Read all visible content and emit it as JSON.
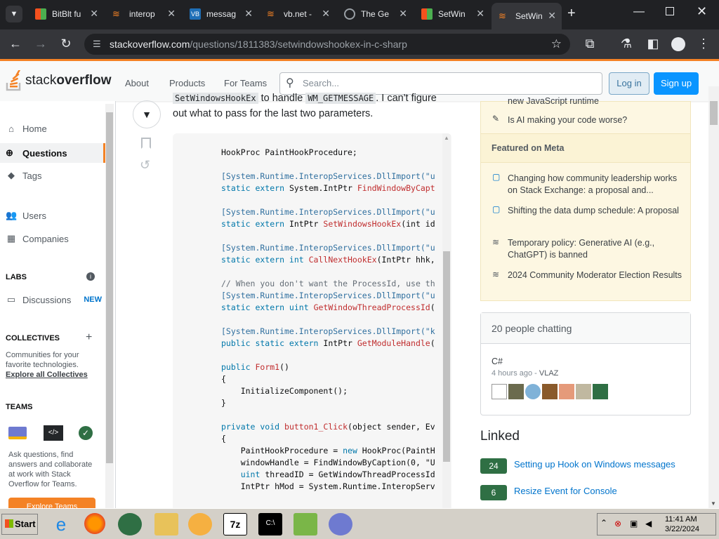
{
  "browser": {
    "tabs": [
      {
        "label": "BitBlt fu",
        "color": "#f4511e"
      },
      {
        "label": "interop",
        "color": "#f48225"
      },
      {
        "label": "messag",
        "color": "#1e6fb7"
      },
      {
        "label": "vb.net -",
        "color": "#f48225"
      },
      {
        "label": "The Ge",
        "color": "#9aa0a6"
      },
      {
        "label": "SetWin",
        "color": "#f4511e"
      },
      {
        "label": "SetWin",
        "color": "#f48225"
      }
    ],
    "url_host": "stackoverflow.com",
    "url_path": "/questions/1811383/setwindowshookex-in-c-sharp"
  },
  "header": {
    "logo_a": "stack",
    "logo_b": "overflow",
    "nav": [
      "About",
      "Products",
      "For Teams"
    ],
    "search_placeholder": "Search...",
    "login": "Log in",
    "signup": "Sign up"
  },
  "leftnav": {
    "home": "Home",
    "questions": "Questions",
    "tags": "Tags",
    "users": "Users",
    "companies": "Companies",
    "labs": "LABS",
    "discussions": "Discussions",
    "new_badge": "NEW",
    "collectives": "COLLECTIVES",
    "collectives_desc1": "Communities for your",
    "collectives_desc2": "favorite technologies.",
    "explore_collectives": "Explore all Collectives",
    "teams": "TEAMS",
    "teams_desc1": "Ask questions, find",
    "teams_desc2": "answers and collaborate",
    "teams_desc3": "at work with Stack",
    "teams_desc4": "Overflow for Teams.",
    "explore_teams": "Explore Teams"
  },
  "question": {
    "text_top_a": "SetWindowsHookEx",
    "text_top_b": " to handle ",
    "text_top_c": "WM_GETMESSAGE",
    "text_top_d": ". I can't figure",
    "text_line2": "out what to pass for the last two parameters."
  },
  "code": {
    "l1": "HookProc PaintHookProcedure;",
    "l2a": "[System.Runtime.InteropServices.DllImport(\"u",
    "l2b_kw": "static extern ",
    "l2b_ty": "System.IntPtr ",
    "l2b_fn": "FindWindowByCapt",
    "l3a": "[System.Runtime.InteropServices.DllImport(\"u",
    "l3b_kw": "static extern ",
    "l3b_ty": "IntPtr ",
    "l3b_fn": "SetWindowsHookEx",
    "l3b_rest": "(int id",
    "l4a": "[System.Runtime.InteropServices.DllImport(\"u",
    "l4b_kw": "static extern int ",
    "l4b_fn": "CallNextHookEx",
    "l4b_rest": "(IntPtr hhk,",
    "l5c": "// When you don't want the ProcessId, use th",
    "l5a": "[System.Runtime.InteropServices.DllImport(\"u",
    "l5b_kw": "static extern uint ",
    "l5b_fn": "GetWindowThreadProcessId",
    "l5b_rest": "(",
    "l6a": "[System.Runtime.InteropServices.DllImport(\"k",
    "l6b_kw": "public static extern ",
    "l6b_ty": "IntPtr ",
    "l6b_fn": "GetModuleHandle",
    "l6b_rest": "(",
    "l7_kw": "public ",
    "l7_fn": "Form1",
    "l7_rest": "()",
    "l8": "{",
    "l9": "    InitializeComponent();",
    "l10": "}",
    "l11_kw": "private void ",
    "l11_fn": "button1_Click",
    "l11_rest": "(object sender, Ev",
    "l12": "{",
    "l13a": "    PaintHookProcedure = ",
    "l13kw": "new ",
    "l13b": "HookProc(PaintH",
    "l14": "    windowHandle = FindWindowByCaption(0, \"U",
    "l15kw": "    uint ",
    "l15": "threadID = GetWindowThreadProcessId",
    "l16": "    IntPtr hMod = System.Runtime.InteropServ"
  },
  "sidebar": {
    "blog_top_partial": "new JavaScript runtime",
    "blog_item2": "Is AI making your code worse?",
    "meta_header": "Featured on Meta",
    "meta_items": [
      "Changing how community leadership works on Stack Exchange: a proposal and...",
      "Shifting the data dump schedule: A proposal",
      "Temporary policy: Generative AI (e.g., ChatGPT) is banned",
      "2024 Community Moderator Election Results"
    ],
    "chat_title": "20 people chatting",
    "chat_room": "C#",
    "chat_time": "4 hours ago",
    "chat_sep": " - ",
    "chat_user": "VLAZ",
    "linked_title": "Linked",
    "linked": [
      {
        "score": "24",
        "title": "Setting up Hook on Windows messages"
      },
      {
        "score": "6",
        "title": "Resize Event for Console"
      }
    ]
  },
  "taskbar": {
    "start": "Start",
    "time": "11:41 AM",
    "date": "3/22/2024"
  }
}
